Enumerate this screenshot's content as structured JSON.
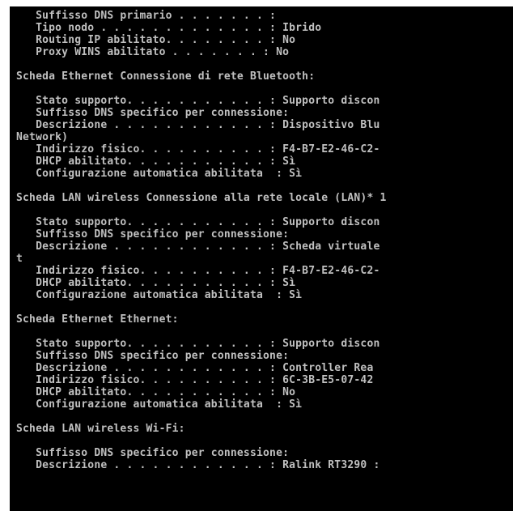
{
  "console": {
    "lines": [
      "   Suffisso DNS primario . . . . . . . :",
      "   Tipo nodo . . . . . . . . . . . . . : Ibrido",
      "   Routing IP abilitato. . . . . . . . : No",
      "   Proxy WINS abilitato . . . . . . . : No",
      "",
      "Scheda Ethernet Connessione di rete Bluetooth:",
      "",
      "   Stato supporto. . . . . . . . . . . : Supporto discon",
      "   Suffisso DNS specifico per connessione:",
      "   Descrizione . . . . . . . . . . . . : Dispositivo Blu",
      "Network)",
      "   Indirizzo fisico. . . . . . . . . . : F4-B7-E2-46-C2-",
      "   DHCP abilitato. . . . . . . . . . . : Sì",
      "   Configurazione automatica abilitata  : Sì",
      "",
      "Scheda LAN wireless Connessione alla rete locale (LAN)* 1",
      "",
      "   Stato supporto. . . . . . . . . . . : Supporto discon",
      "   Suffisso DNS specifico per connessione:",
      "   Descrizione . . . . . . . . . . . . : Scheda virtuale",
      "t",
      "   Indirizzo fisico. . . . . . . . . . : F4-B7-E2-46-C2-",
      "   DHCP abilitato. . . . . . . . . . . : Sì",
      "   Configurazione automatica abilitata  : Sì",
      "",
      "Scheda Ethernet Ethernet:",
      "",
      "   Stato supporto. . . . . . . . . . . : Supporto discon",
      "   Suffisso DNS specifico per connessione:",
      "   Descrizione . . . . . . . . . . . . : Controller Rea",
      "   Indirizzo fisico. . . . . . . . . . : 6C-3B-E5-07-42",
      "   DHCP abilitato. . . . . . . . . . . : No",
      "   Configurazione automatica abilitata  : Sì",
      "",
      "Scheda LAN wireless Wi-Fi:",
      "",
      "   Suffisso DNS specifico per connessione:",
      "   Descrizione . . . . . . . . . . . . : Ralink RT3290 :"
    ]
  }
}
